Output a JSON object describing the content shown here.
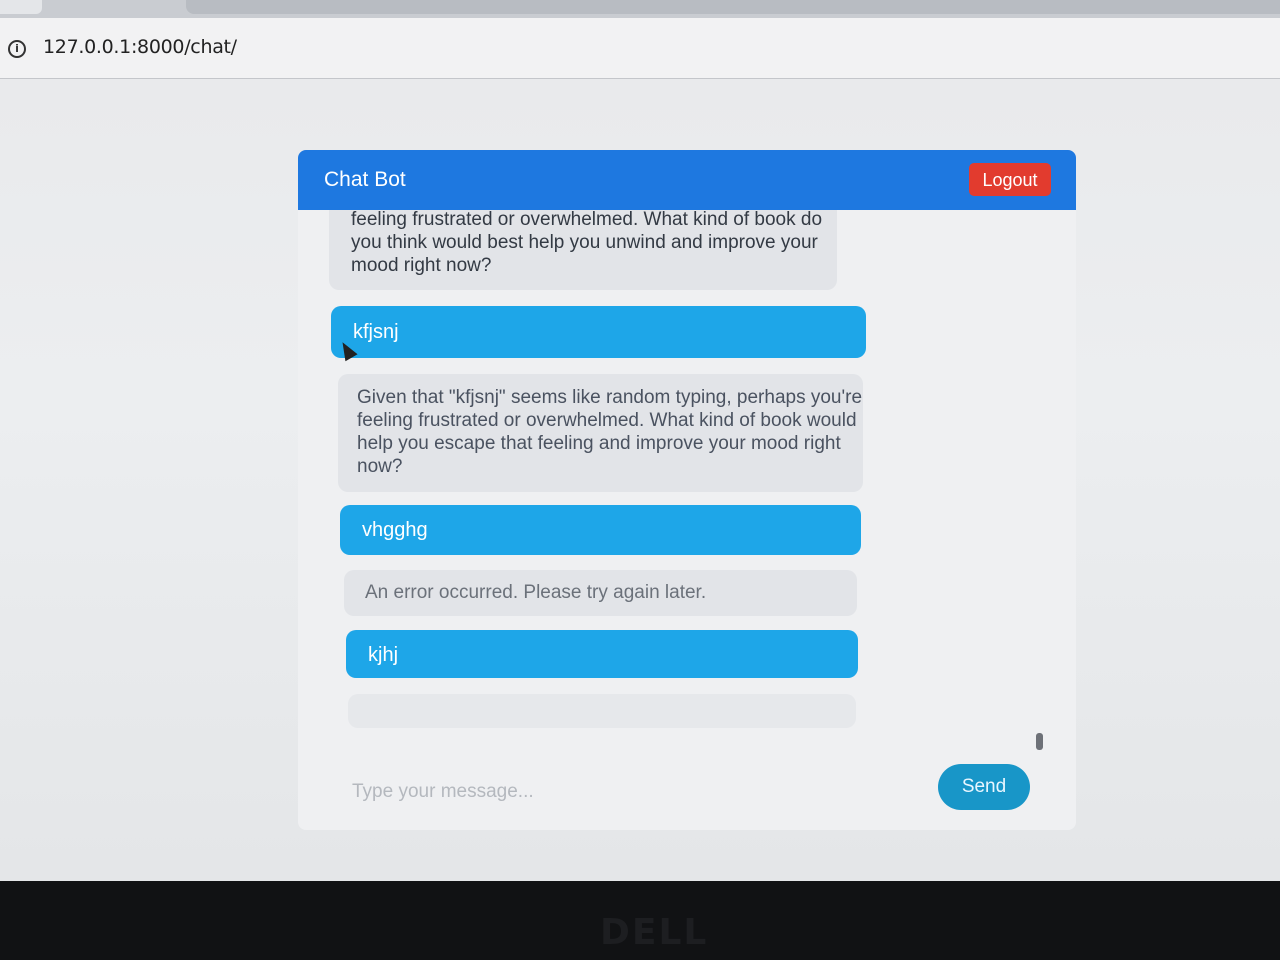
{
  "browser": {
    "url": "127.0.0.1:8000/chat/",
    "info_icon": "info-icon"
  },
  "header": {
    "title": "Chat Bot",
    "logout_label": "Logout"
  },
  "messages": [
    {
      "role": "bot",
      "text": "feeling frustrated or overwhelmed. What kind of book do you think would best help you unwind and improve your mood right now?"
    },
    {
      "role": "user",
      "text": "kfjsnj"
    },
    {
      "role": "bot",
      "text": "Given that \"kfjsnj\" seems like random typing, perhaps you're feeling frustrated or overwhelmed. What kind of book would help you escape that feeling and improve your mood right now?"
    },
    {
      "role": "user",
      "text": "vhgghg"
    },
    {
      "role": "bot",
      "text": "An error occurred. Please try again later."
    },
    {
      "role": "user",
      "text": "kjhj"
    }
  ],
  "composer": {
    "placeholder": "Type your message...",
    "send_label": "Send"
  },
  "device": {
    "brand": "DELL"
  },
  "colors": {
    "header": "#1e78e0",
    "logout": "#e23b2e",
    "user_bubble": "#1ea6e8",
    "bot_bubble": "#e2e4e8",
    "send": "#1896c8"
  }
}
